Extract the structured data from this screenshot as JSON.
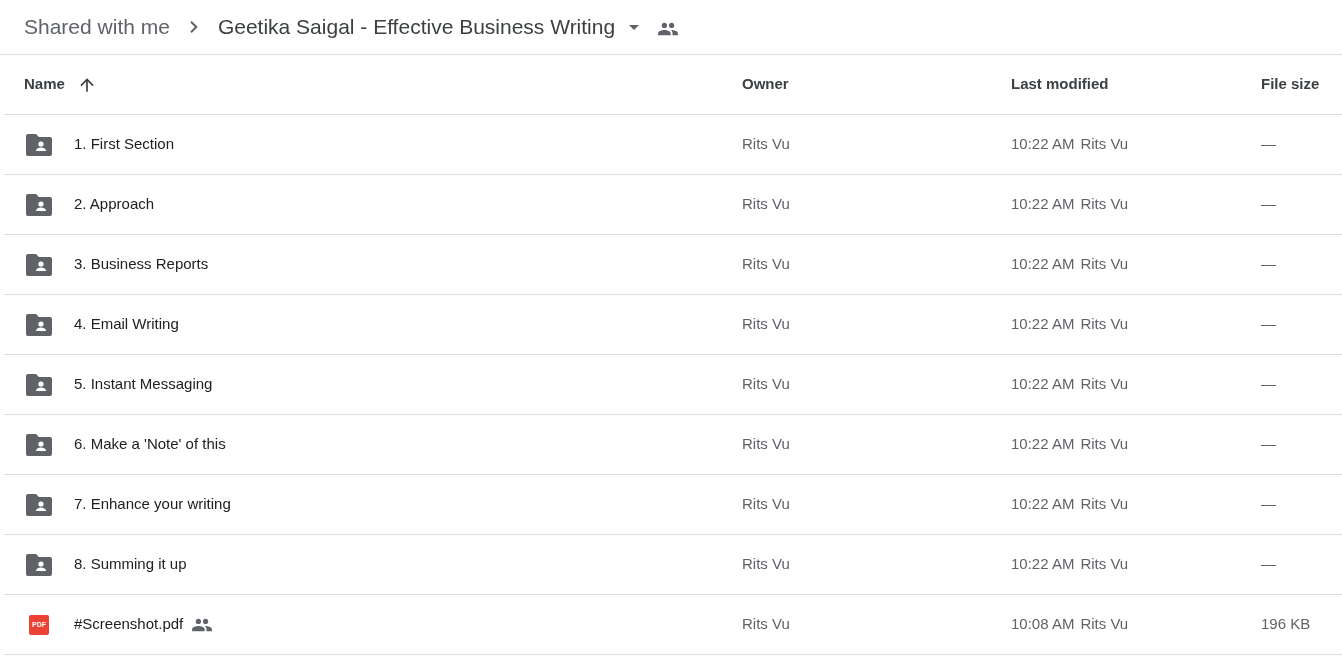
{
  "breadcrumb": {
    "parent": "Shared with me",
    "current": "Geetika Saigal - Effective Business Writing"
  },
  "table": {
    "columns": [
      "Name",
      "Owner",
      "Last modified",
      "File size"
    ],
    "rows": [
      {
        "kind": "folder",
        "name": "1. First Section",
        "shared": false,
        "owner": "Rits Vu",
        "modified_time": "10:22 AM",
        "modified_by": "Rits Vu",
        "size": "—"
      },
      {
        "kind": "folder",
        "name": "2. Approach",
        "shared": false,
        "owner": "Rits Vu",
        "modified_time": "10:22 AM",
        "modified_by": "Rits Vu",
        "size": "—"
      },
      {
        "kind": "folder",
        "name": "3. Business Reports",
        "shared": false,
        "owner": "Rits Vu",
        "modified_time": "10:22 AM",
        "modified_by": "Rits Vu",
        "size": "—"
      },
      {
        "kind": "folder",
        "name": "4. Email Writing",
        "shared": false,
        "owner": "Rits Vu",
        "modified_time": "10:22 AM",
        "modified_by": "Rits Vu",
        "size": "—"
      },
      {
        "kind": "folder",
        "name": "5. Instant Messaging",
        "shared": false,
        "owner": "Rits Vu",
        "modified_time": "10:22 AM",
        "modified_by": "Rits Vu",
        "size": "—"
      },
      {
        "kind": "folder",
        "name": "6. Make a 'Note' of this",
        "shared": false,
        "owner": "Rits Vu",
        "modified_time": "10:22 AM",
        "modified_by": "Rits Vu",
        "size": "—"
      },
      {
        "kind": "folder",
        "name": "7. Enhance your writing",
        "shared": false,
        "owner": "Rits Vu",
        "modified_time": "10:22 AM",
        "modified_by": "Rits Vu",
        "size": "—"
      },
      {
        "kind": "folder",
        "name": "8. Summing it up",
        "shared": false,
        "owner": "Rits Vu",
        "modified_time": "10:22 AM",
        "modified_by": "Rits Vu",
        "size": "—"
      },
      {
        "kind": "pdf",
        "badge": "PDF",
        "name": "#Screenshot.pdf",
        "shared": true,
        "owner": "Rits Vu",
        "modified_time": "10:08 AM",
        "modified_by": "Rits Vu",
        "size": "196 KB"
      }
    ]
  }
}
